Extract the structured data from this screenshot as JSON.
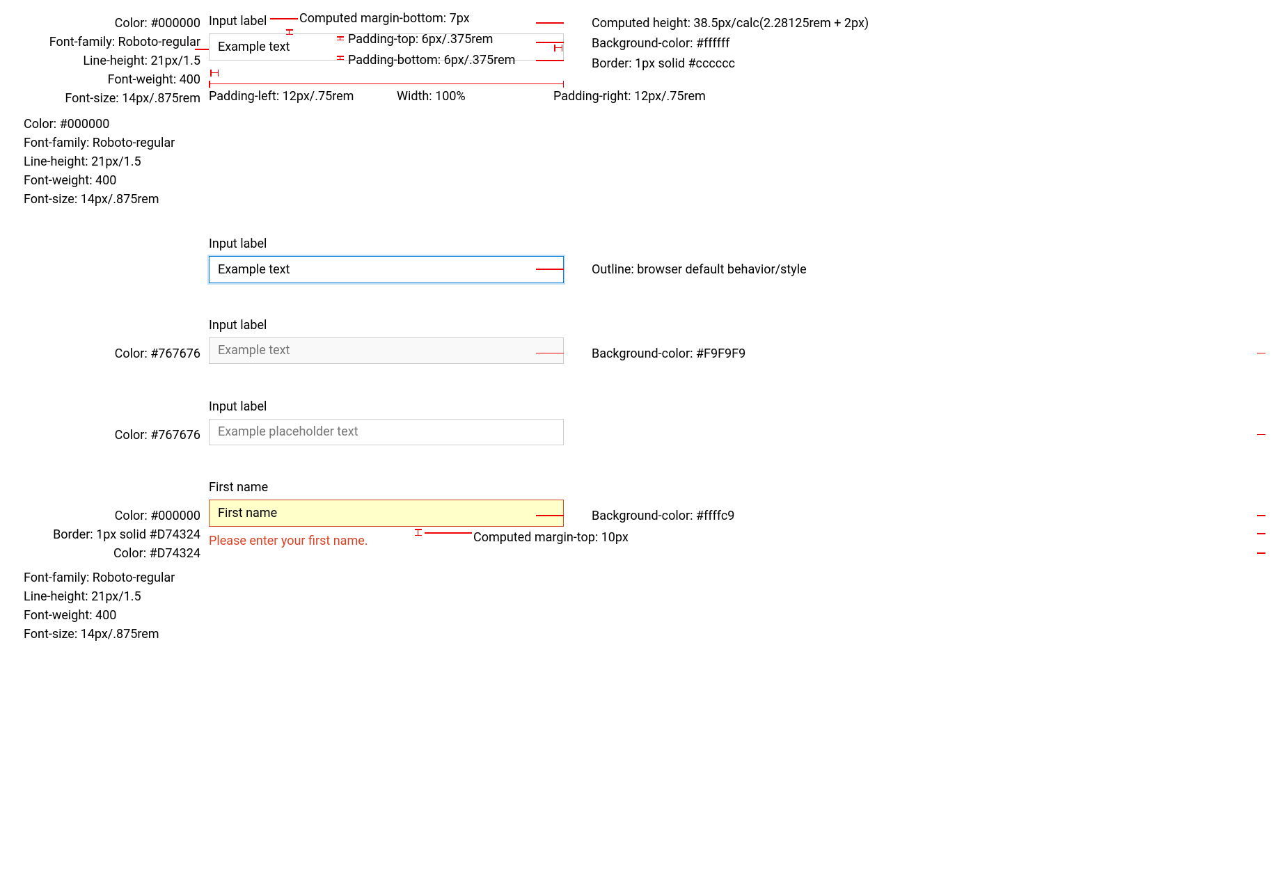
{
  "rows": [
    {
      "leftSpecs": [
        "Color: #000000",
        "Font-family: Roboto-regular",
        "Line-height: 21px/1.5",
        "Font-weight: 400",
        "Font-size: 14px/.875rem"
      ],
      "label": "Input label",
      "value": "Example text",
      "rightSpecs": [
        "Computed height: 38.5px/calc(2.28125rem + 2px)",
        "Background-color: #ffffff",
        "Border: 1px solid #cccccc"
      ],
      "topAnnots": {
        "marginBottom": "Computed margin-bottom: 7px",
        "paddingTop": "Padding-top: 6px/.375rem",
        "paddingBottom": "Padding-bottom: 6px/.375rem"
      },
      "bottomAnnots": {
        "paddingLeft": "Padding-left: 12px/.75rem",
        "width": "Width: 100%",
        "paddingRight": "Padding-right: 12px/.75rem"
      },
      "belowLeft": [
        "Color: #000000",
        "Font-family: Roboto-regular",
        "Line-height: 21px/1.5",
        "Font-weight: 400",
        "Font-size: 14px/.875rem"
      ]
    },
    {
      "leftSpecs": [],
      "label": "Input label",
      "value": "Example text",
      "state": "focused",
      "rightSpecs": [
        "Outline: browser default behavior/style"
      ]
    },
    {
      "leftSpecs": [
        "Color: #767676"
      ],
      "label": "Input label",
      "value": "Example text",
      "state": "disabled",
      "rightSpecs": [
        "Background-color: #F9F9F9"
      ]
    },
    {
      "leftSpecs": [
        "Color: #767676"
      ],
      "label": "Input label",
      "placeholder": "Example placeholder text",
      "value": "",
      "rightSpecs": []
    },
    {
      "leftSpecs": [
        "Color: #000000",
        "Border: 1px solid #D74324",
        "Color: #D74324"
      ],
      "label": "First name",
      "value": "First name",
      "state": "error",
      "errorMessage": "Please enter your first name.",
      "rightSpecs": [
        "Background-color: #ffffc9"
      ],
      "errorMarginTop": "Computed margin-top: 10px",
      "belowLeft": [
        "Font-family: Roboto-regular",
        "Line-height: 21px/1.5",
        "Font-weight: 400",
        "Font-size: 14px/.875rem"
      ]
    }
  ]
}
